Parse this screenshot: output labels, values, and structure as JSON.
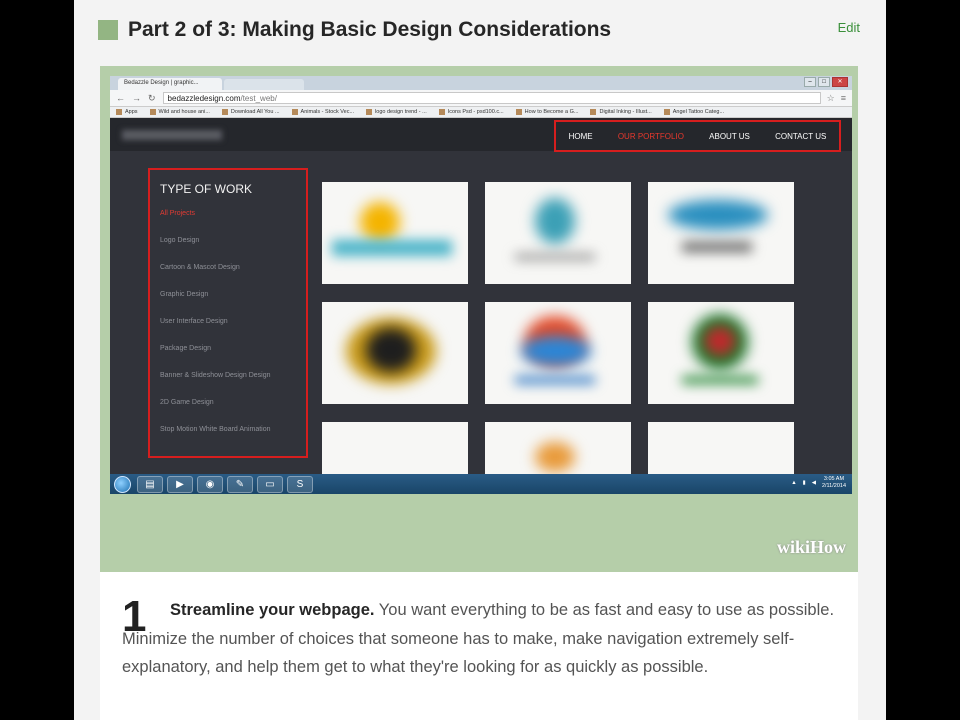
{
  "part": {
    "title": "Part 2 of 3: Making Basic Design Considerations",
    "edit_label": "Edit"
  },
  "browser": {
    "tab_title": "Bedazzle Design | graphic...",
    "url_host": "bedazzledesign.com",
    "url_path": "/test_web/",
    "bookmarks": [
      "Apps",
      "Wild and house ani...",
      "Download All You ...",
      "Animals - Stock Vec...",
      "logo design trend - ...",
      "Icons Psd - psd100.c...",
      "How to Become a G...",
      "Digital Inking - Illust...",
      "Angel Tattoo Categ..."
    ]
  },
  "site": {
    "nav": [
      "HOME",
      "OUR PORTFOLIO",
      "ABOUT US",
      "CONTACT US"
    ],
    "nav_active": "OUR PORTFOLIO",
    "sidebar_title": "TYPE OF WORK",
    "sidebar_items": [
      "All Projects",
      "Logo Design",
      "Cartoon & Mascot Design",
      "Graphic Design",
      "User Interface Design",
      "Package Design",
      "Banner & Slideshow Design Design",
      "2D Game Design",
      "Stop Motion White Board Animation"
    ],
    "sidebar_active": "All Projects"
  },
  "taskbar": {
    "time": "3:05 AM",
    "date": "2/11/2014"
  },
  "watermark": "wikiHow",
  "step": {
    "number": "1",
    "bold": "Streamline your webpage.",
    "text": " You want everything to be as fast and easy to use as possible. Minimize the number of choices that someone has to make, make navigation extremely self-explanatory, and help them get to what they're looking for as quickly as possible."
  },
  "colors": {
    "accent_green": "#93b583",
    "highlight_red": "#d61e1e",
    "link_green": "#3a8f3a"
  }
}
